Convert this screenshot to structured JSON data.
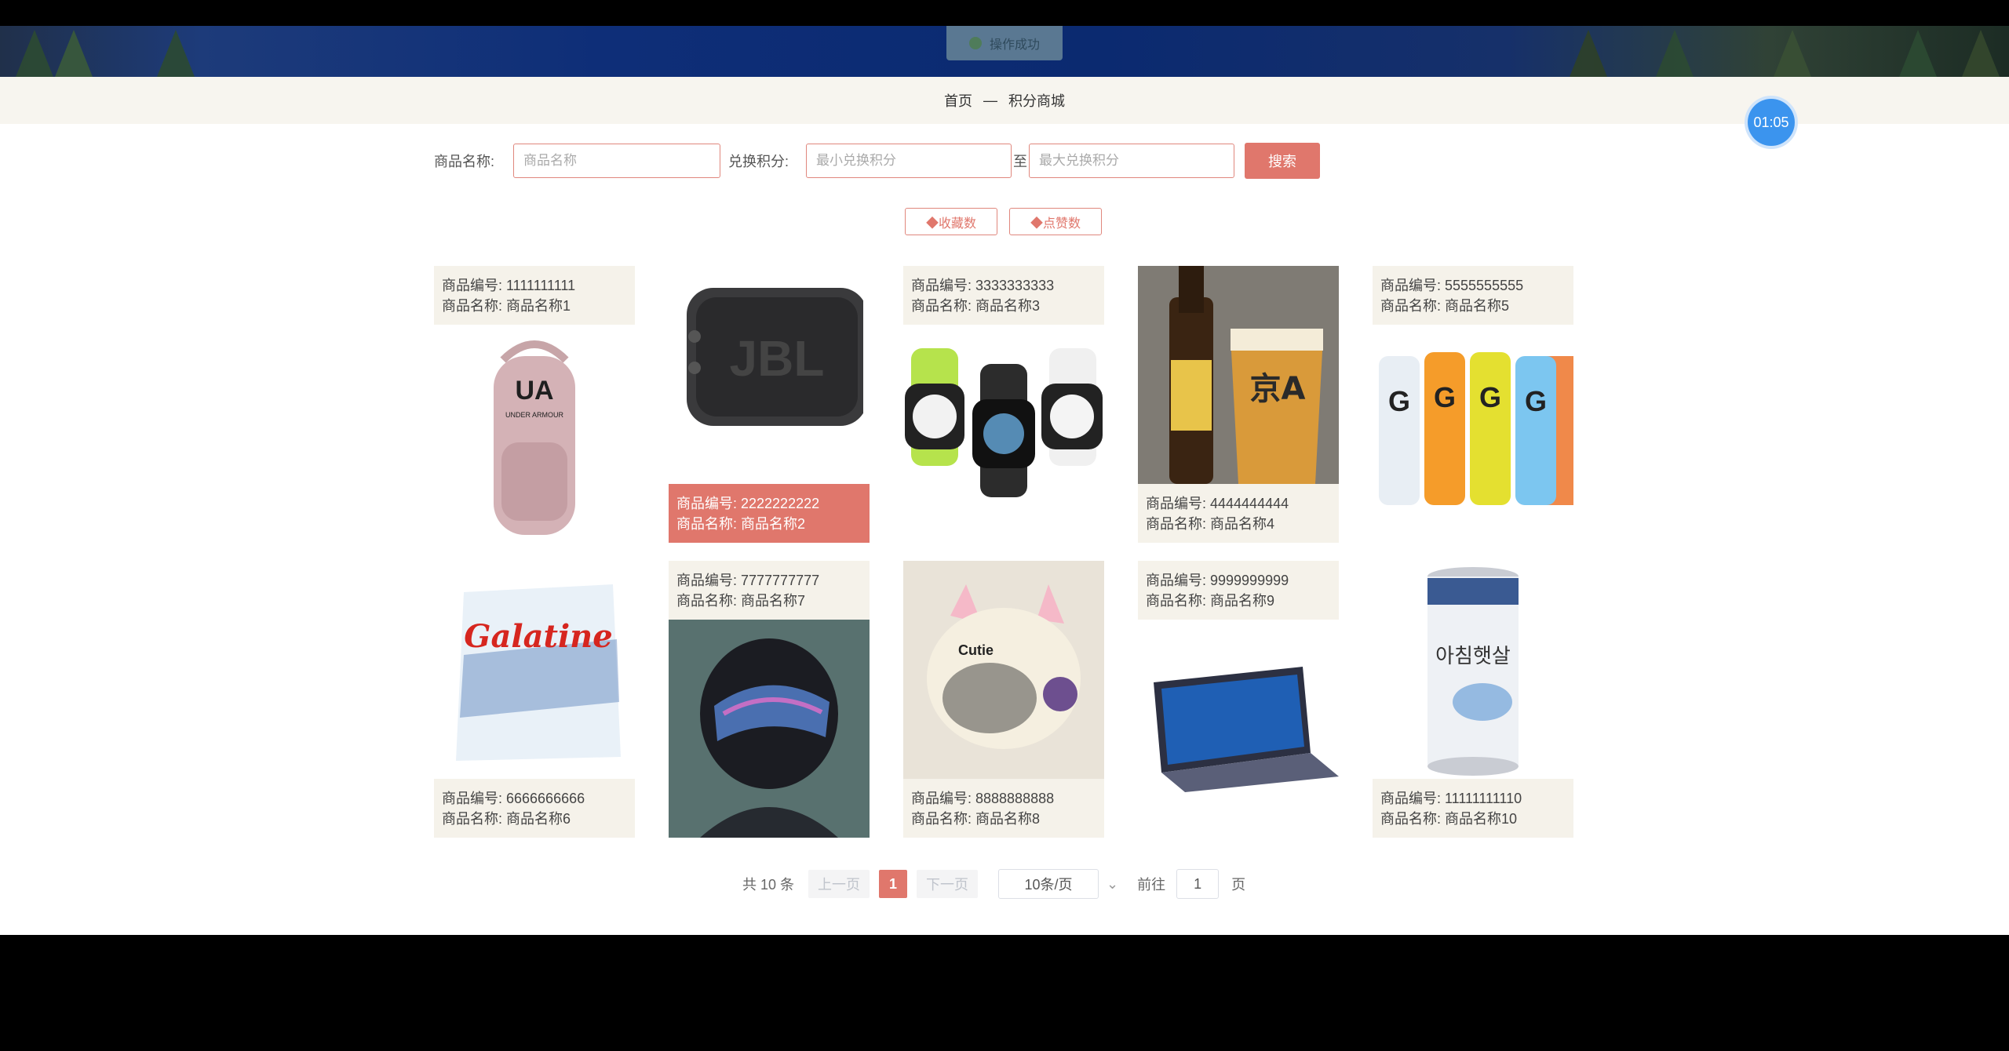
{
  "toast": {
    "text": "操作成功"
  },
  "breadcrumb": {
    "home": "首页",
    "sep": "—",
    "current": "积分商城"
  },
  "timer": "01:05",
  "search": {
    "name_label": "商品名称:",
    "name_placeholder": "商品名称",
    "points_label": "兑换积分:",
    "min_placeholder": "最小兑换积分",
    "to": "至",
    "max_placeholder": "最大兑换积分",
    "button": "搜索"
  },
  "sort": {
    "favorites": "◆收藏数",
    "likes": "◆点赞数"
  },
  "products": [
    {
      "code": "商品编号: 1111111111",
      "name": "商品名称: 商品名称1",
      "image": "backpack"
    },
    {
      "code": "商品编号: 2222222222",
      "name": "商品名称: 商品名称2",
      "image": "speaker"
    },
    {
      "code": "商品编号: 3333333333",
      "name": "商品名称: 商品名称3",
      "image": "smartwatches"
    },
    {
      "code": "商品编号: 4444444444",
      "name": "商品名称: 商品名称4",
      "image": "beer"
    },
    {
      "code": "商品编号: 5555555555",
      "name": "商品名称: 商品名称5",
      "image": "sports-drinks"
    },
    {
      "code": "商品编号: 6666666666",
      "name": "商品名称: 商品名称6",
      "image": "candy-bag"
    },
    {
      "code": "商品编号: 7777777777",
      "name": "商品名称: 商品名称7",
      "image": "helmet"
    },
    {
      "code": "商品编号: 8888888888",
      "name": "商品名称: 商品名称8",
      "image": "cat-helmet"
    },
    {
      "code": "商品编号: 9999999999",
      "name": "商品名称: 商品名称9",
      "image": "laptop"
    },
    {
      "code": "商品编号: 11111111110",
      "name": "商品名称: 商品名称10",
      "image": "drink-can"
    }
  ],
  "image_text": {
    "backpack": "UNDER ARMOUR",
    "speaker": "JBL",
    "beer": "京A",
    "drinks": "G",
    "candy": "Galatine",
    "can": "아침햇살"
  },
  "pagination": {
    "total": "共 10 条",
    "prev": "上一页",
    "current": "1",
    "next": "下一页",
    "page_size": "10条/页",
    "goto": "前往",
    "goto_value": "1",
    "page_unit": "页"
  },
  "colors": {
    "accent": "#e0776c",
    "info_bg": "#f5f2ea",
    "crumb_bg": "#f7f5ef",
    "timer": "#3b94ee"
  }
}
